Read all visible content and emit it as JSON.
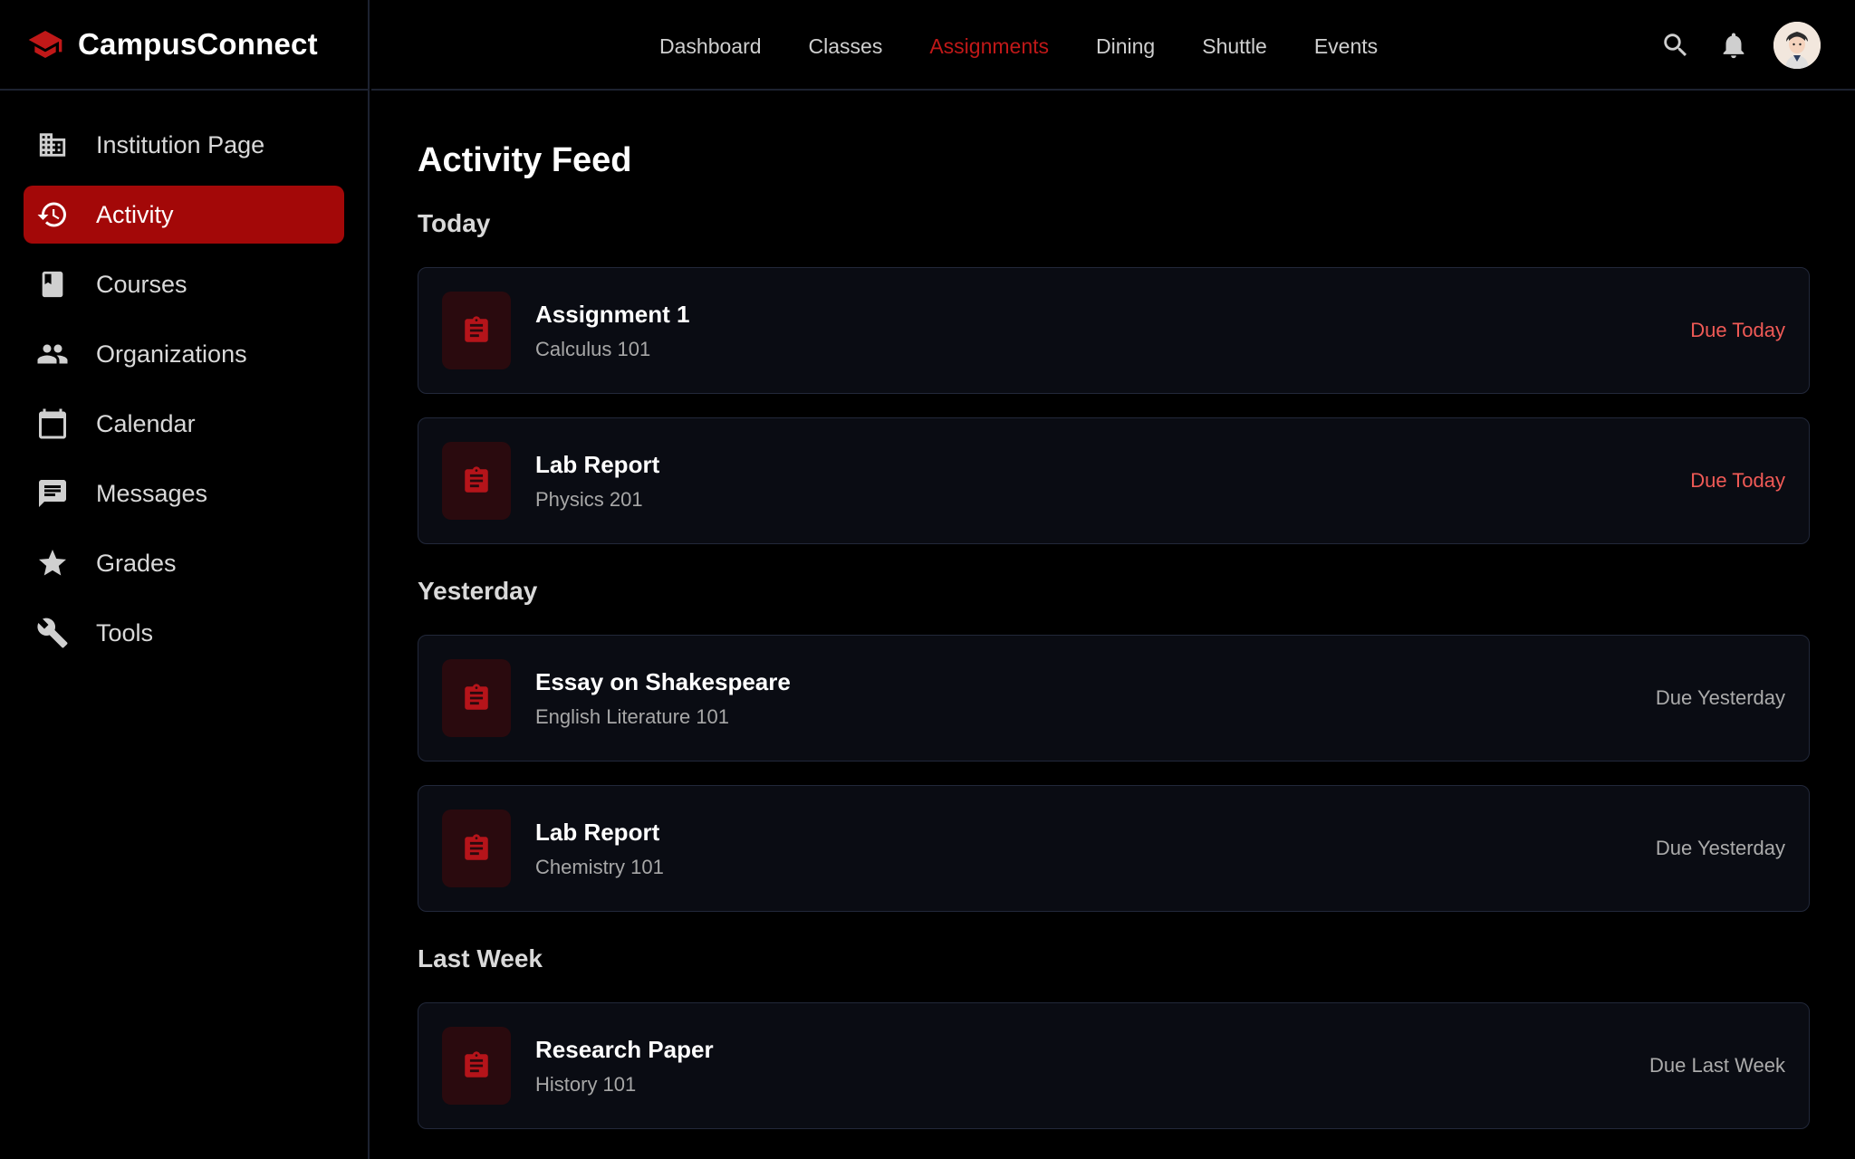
{
  "brand": {
    "name": "CampusConnect"
  },
  "colors": {
    "accent": "#a30808",
    "accent_text": "#c01818",
    "due_today": "#f05a56",
    "background": "#000000",
    "card_bg": "#0a0c13"
  },
  "sidebar": {
    "items": [
      {
        "label": "Institution Page",
        "icon": "building-icon"
      },
      {
        "label": "Activity",
        "icon": "history-icon",
        "active": true
      },
      {
        "label": "Courses",
        "icon": "book-icon"
      },
      {
        "label": "Organizations",
        "icon": "people-icon"
      },
      {
        "label": "Calendar",
        "icon": "calendar-icon"
      },
      {
        "label": "Messages",
        "icon": "message-icon"
      },
      {
        "label": "Grades",
        "icon": "star-icon"
      },
      {
        "label": "Tools",
        "icon": "wrench-icon"
      }
    ]
  },
  "topnav": {
    "links": [
      {
        "label": "Dashboard"
      },
      {
        "label": "Classes"
      },
      {
        "label": "Assignments",
        "active": true
      },
      {
        "label": "Dining"
      },
      {
        "label": "Shuttle"
      },
      {
        "label": "Events"
      }
    ],
    "icons": [
      "search-icon",
      "bell-icon"
    ]
  },
  "main": {
    "title": "Activity Feed",
    "sections": [
      {
        "title": "Today",
        "items": [
          {
            "title": "Assignment 1",
            "course": "Calculus 101",
            "due": "Due Today",
            "status": "today"
          },
          {
            "title": "Lab Report",
            "course": "Physics 201",
            "due": "Due Today",
            "status": "today"
          }
        ]
      },
      {
        "title": "Yesterday",
        "items": [
          {
            "title": "Essay on Shakespeare",
            "course": "English Literature 101",
            "due": "Due Yesterday",
            "status": "past"
          },
          {
            "title": "Lab Report",
            "course": "Chemistry 101",
            "due": "Due Yesterday",
            "status": "past"
          }
        ]
      },
      {
        "title": "Last Week",
        "items": [
          {
            "title": "Research Paper",
            "course": "History 101",
            "due": "Due Last Week",
            "status": "past"
          }
        ]
      }
    ]
  }
}
